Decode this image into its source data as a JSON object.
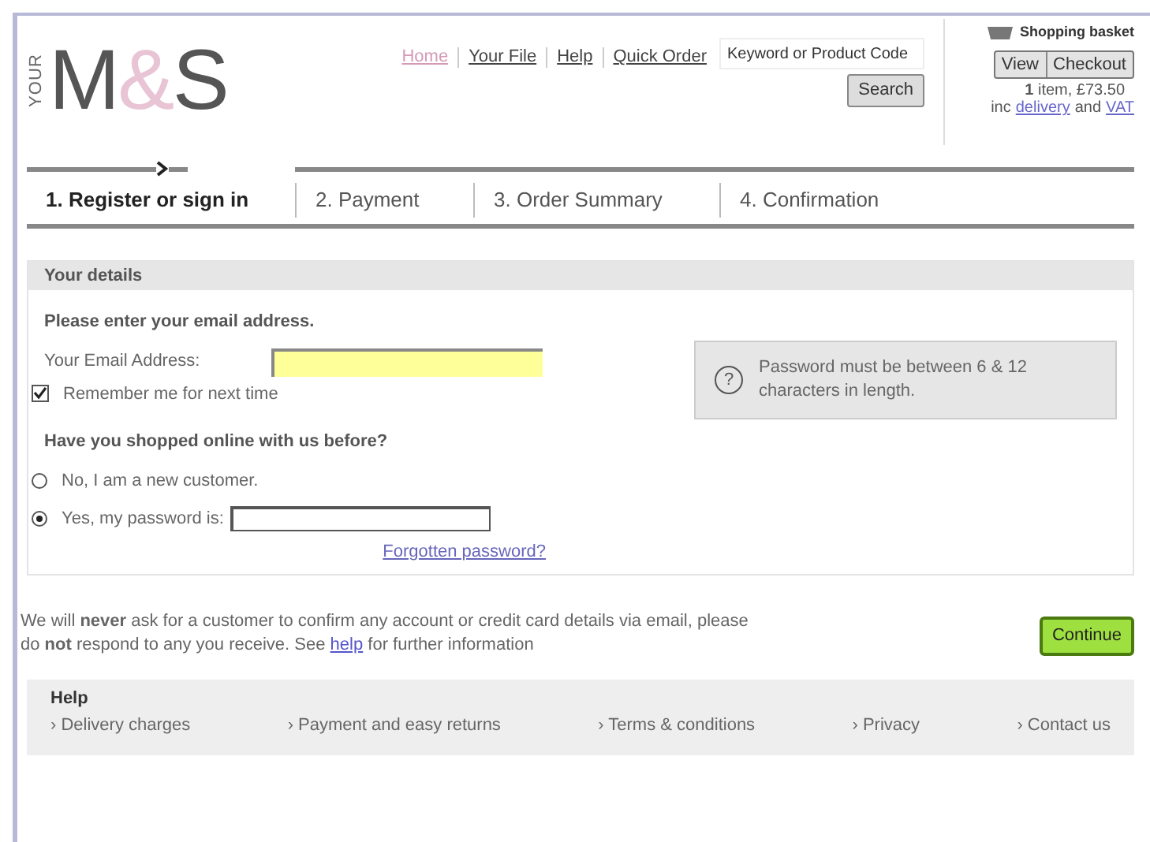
{
  "logo": {
    "your": "YOUR",
    "m": "M",
    "amp": "&",
    "s": "S"
  },
  "nav": [
    {
      "label": "Home",
      "selected": true
    },
    {
      "label": "Your File",
      "selected": false
    },
    {
      "label": "Help",
      "selected": false
    },
    {
      "label": "Quick Order",
      "selected": false
    }
  ],
  "search": {
    "placeholder": "Keyword or Product Code",
    "button": "Search"
  },
  "basket": {
    "title": "Shopping basket",
    "view": "View",
    "checkout": "Checkout",
    "count": "1",
    "summary": " item, £73.50",
    "inc": "inc",
    "delivery": "delivery",
    "and": "and",
    "vat": "VAT"
  },
  "steps": [
    {
      "label": "1. Register or sign in",
      "selected": true
    },
    {
      "label": "2. Payment",
      "selected": false
    },
    {
      "label": "3. Order Summary",
      "selected": false
    },
    {
      "label": "4. Confirmation",
      "selected": false
    }
  ],
  "details": {
    "title": "Your details",
    "prompt": "Please enter your email address.",
    "email_label": "Your Email Address:",
    "remember": {
      "label": "Remember me for next time",
      "checked": true
    },
    "question": "Have you shopped online with us before?",
    "options": [
      {
        "label": "No, I am a new customer.",
        "selected": false,
        "kind": "plain"
      },
      {
        "label": "Yes, my password is:",
        "selected": true,
        "kind": "password"
      }
    ],
    "forgotten": "Forgotten password?",
    "hint": "Password must be between 6 & 12 characters in length.",
    "hint_icon": "?"
  },
  "notice": {
    "before": "We will **never** ask for a customer to confirm any account or credit card details via email, please do **not** respond to any you receive. See",
    "link": "help",
    "after": "for further information"
  },
  "continue": "Continue",
  "footer": {
    "title": "Help",
    "links": [
      "› Delivery charges",
      "› Payment and easy returns",
      "› Terms & conditions",
      "› Privacy",
      "› Contact us"
    ]
  }
}
